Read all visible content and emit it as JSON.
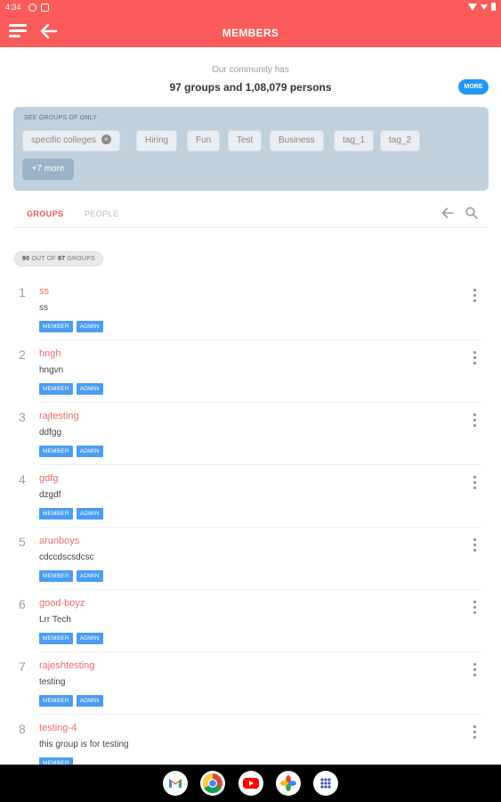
{
  "status_bar": {
    "time": "4:34"
  },
  "app_bar": {
    "title": "MEMBERS"
  },
  "summary": {
    "subtitle": "Our community has",
    "headline": "97 groups and 1,08,079 persons",
    "more_label": "MORE"
  },
  "filters": {
    "label": "SEE GROUPS OF ONLY",
    "chips": [
      "specific colleges",
      "Hiring",
      "Fun",
      "Test",
      "Business",
      "tag_1",
      "tag_2"
    ],
    "more_label": "+7 more"
  },
  "tabs": {
    "groups": "GROUPS",
    "people": "PEOPLE"
  },
  "count_pill": {
    "shown": "90",
    "middle": "OUT OF",
    "total": "97",
    "suffix": "GROUPS"
  },
  "groups": [
    {
      "num": "1",
      "title": "ss",
      "desc": "ss",
      "badges": [
        "MEMBER",
        "ADMIN"
      ]
    },
    {
      "num": "2",
      "title": "hngh",
      "desc": "hngvn",
      "badges": [
        "MEMBER",
        "ADMIN"
      ]
    },
    {
      "num": "3",
      "title": "rajtesting",
      "desc": "ddfgg",
      "badges": [
        "MEMBER",
        "ADMIN"
      ]
    },
    {
      "num": "4",
      "title": "gdfg",
      "desc": "dzgdf",
      "badges": [
        "MEMBER",
        "ADMIN"
      ]
    },
    {
      "num": "5",
      "title": "arunboys",
      "desc": "cdccdscsdcsc",
      "badges": [
        "MEMBER",
        "ADMIN"
      ]
    },
    {
      "num": "6",
      "title": "good-boyz",
      "desc": "Lrr Tech",
      "badges": [
        "MEMBER",
        "ADMIN"
      ]
    },
    {
      "num": "7",
      "title": "rajeshtesting",
      "desc": "testing",
      "badges": [
        "MEMBER",
        "ADMIN"
      ]
    },
    {
      "num": "8",
      "title": "testing-4",
      "desc": "this group is for testing",
      "badges": [
        "MEMBER"
      ]
    }
  ],
  "dock": {
    "apps": [
      {
        "icon": "gmail-icon",
        "color": "#ea4335"
      },
      {
        "icon": "chrome-icon",
        "color": "#4caf50"
      },
      {
        "icon": "youtube-icon",
        "color": "#ff0000"
      },
      {
        "icon": "photos-icon",
        "color": "#fbbc05"
      },
      {
        "icon": "app-drawer-icon",
        "color": "#3f51b5"
      }
    ]
  },
  "colors": {
    "accent": "#fb5b5b",
    "link_red": "#f06a6a",
    "badge_blue": "#4a9df2",
    "more_blue": "#2196f3",
    "filter_panel": "#c1d0dd"
  }
}
